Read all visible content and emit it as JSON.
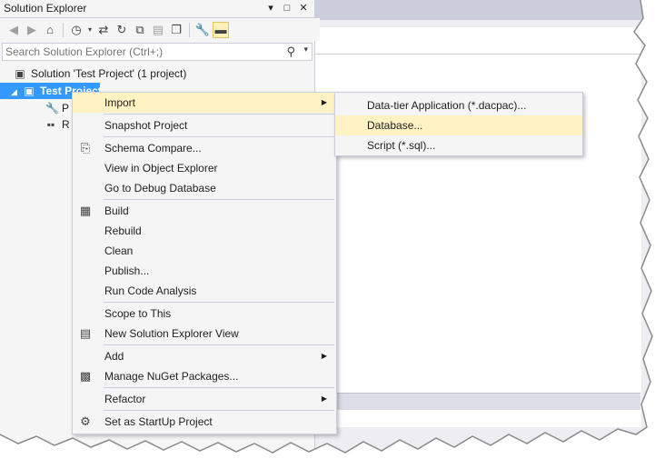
{
  "panel": {
    "title": "Solution Explorer",
    "title_buttons": [
      "chevron-down-icon",
      "maximize-icon",
      "close-icon"
    ]
  },
  "toolbar": {
    "icons": [
      "back-icon",
      "forward-icon",
      "home-icon",
      "history-icon",
      "sync-icon",
      "refresh-icon",
      "collapse-all-icon",
      "show-all-files-icon",
      "copy-icon",
      "properties-icon",
      "preview-icon"
    ]
  },
  "search": {
    "placeholder": "Search Solution Explorer (Ctrl+;)"
  },
  "tree": {
    "solution_label": "Solution 'Test Project' (1 project)",
    "project_label": "Test Project",
    "children": [
      {
        "label": "P"
      },
      {
        "label": "R"
      }
    ]
  },
  "context_menu": {
    "items": [
      {
        "label": "Import",
        "has_submenu": true,
        "icon": ""
      },
      {
        "label": "Snapshot Project",
        "icon": ""
      },
      {
        "label": "Schema Compare...",
        "icon": "schema-compare-icon"
      },
      {
        "label": "View in Object Explorer",
        "icon": ""
      },
      {
        "label": "Go to Debug Database",
        "icon": ""
      },
      {
        "label": "Build",
        "icon": "build-icon"
      },
      {
        "label": "Rebuild",
        "icon": ""
      },
      {
        "label": "Clean",
        "icon": ""
      },
      {
        "label": "Publish...",
        "icon": ""
      },
      {
        "label": "Run Code Analysis",
        "icon": ""
      },
      {
        "label": "Scope to This",
        "icon": ""
      },
      {
        "label": "New Solution Explorer View",
        "icon": "new-view-icon"
      },
      {
        "label": "Add",
        "has_submenu": true,
        "icon": ""
      },
      {
        "label": "Manage NuGet Packages...",
        "icon": "nuget-icon"
      },
      {
        "label": "Refactor",
        "has_submenu": true,
        "icon": ""
      },
      {
        "label": "Set as StartUp Project",
        "icon": "gear-icon"
      }
    ]
  },
  "import_submenu": {
    "items": [
      {
        "label": "Data-tier Application (*.dacpac)..."
      },
      {
        "label": "Database..."
      },
      {
        "label": "Script (*.sql)..."
      }
    ]
  },
  "colors": {
    "selection": "#3399ff",
    "menu_highlight": "#fff3c3",
    "menu_background": "#f5f5f5"
  }
}
